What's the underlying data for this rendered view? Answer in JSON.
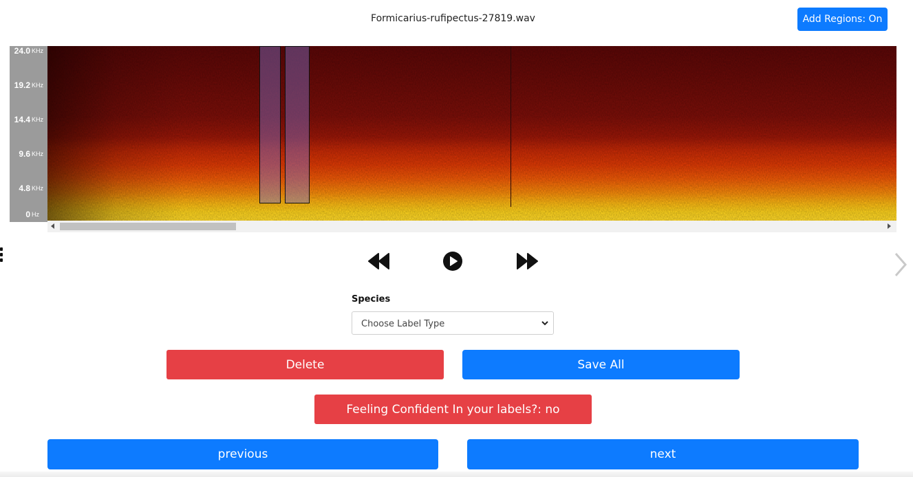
{
  "header": {
    "filename": "Formicarius-rufipectus-27819.wav",
    "add_regions_label": "Add Regions: On"
  },
  "spectrogram": {
    "frequency_ticks": [
      {
        "value": "24.0",
        "unit": "KHz"
      },
      {
        "value": "19.2",
        "unit": "KHz"
      },
      {
        "value": "14.4",
        "unit": "KHz"
      },
      {
        "value": "9.6",
        "unit": "KHz"
      },
      {
        "value": "4.8",
        "unit": "KHz"
      },
      {
        "value": "0",
        "unit": "Hz"
      }
    ]
  },
  "player": {
    "rewind_icon": "rewind-icon",
    "play_icon": "play-icon",
    "forward_icon": "fast-forward-icon"
  },
  "form": {
    "species_label": "Species",
    "select_value": "Choose Label Type"
  },
  "actions": {
    "delete_label": "Delete",
    "save_all_label": "Save All",
    "confident_label": "Feeling Confident In your labels?: no",
    "previous_label": "previous",
    "next_label": "next"
  },
  "colors": {
    "primary": "#0d7bff",
    "danger": "#e64045"
  }
}
